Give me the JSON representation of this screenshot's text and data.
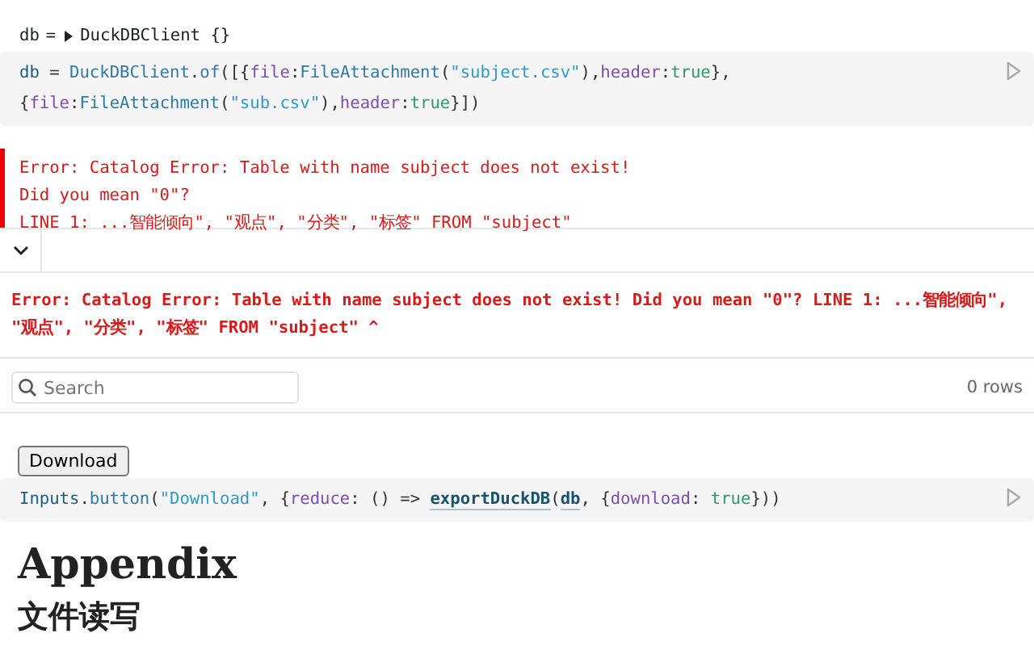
{
  "cells": [
    {
      "kind": "output",
      "name": "db",
      "sep": "=",
      "expanded": false,
      "value": "DuckDBClient {}"
    },
    {
      "kind": "code",
      "lines": [
        [
          {
            "t": "db",
            "kind": "var"
          },
          {
            "t": " = ",
            "kind": "plain"
          },
          {
            "t": "DuckDBClient",
            "kind": "def"
          },
          {
            "t": ".",
            "kind": "plain"
          },
          {
            "t": "of",
            "kind": "def"
          },
          {
            "t": "([{",
            "kind": "plain"
          },
          {
            "t": "file",
            "kind": "prop"
          },
          {
            "t": ":",
            "kind": "plain"
          },
          {
            "t": "FileAttachment",
            "kind": "def"
          },
          {
            "t": "(",
            "kind": "plain"
          },
          {
            "t": "\"subject.csv\"",
            "kind": "string"
          },
          {
            "t": "),",
            "kind": "plain"
          },
          {
            "t": "header",
            "kind": "prop"
          },
          {
            "t": ":",
            "kind": "plain"
          },
          {
            "t": "true",
            "kind": "bool"
          },
          {
            "t": "},",
            "kind": "plain"
          }
        ],
        [
          {
            "t": "{",
            "kind": "plain"
          },
          {
            "t": "file",
            "kind": "prop"
          },
          {
            "t": ":",
            "kind": "plain"
          },
          {
            "t": "FileAttachment",
            "kind": "def"
          },
          {
            "t": "(",
            "kind": "plain"
          },
          {
            "t": "\"sub.csv\"",
            "kind": "string"
          },
          {
            "t": "),",
            "kind": "plain"
          },
          {
            "t": "header",
            "kind": "prop"
          },
          {
            "t": ":",
            "kind": "plain"
          },
          {
            "t": "true",
            "kind": "bool"
          },
          {
            "t": "}])",
            "kind": "plain"
          }
        ]
      ]
    },
    {
      "kind": "error",
      "lines": [
        "Error: Catalog Error: Table with name subject does not exist!",
        "Did you mean \"0\"?",
        "LINE 1: ...智能倾向\", \"观点\", \"分类\", \"标签\" FROM \"subject\""
      ]
    },
    {
      "kind": "table",
      "expanded": true,
      "error": "Error: Catalog Error: Table with name subject does not exist! Did you mean \"0\"? LINE 1: ...智能倾向\", \"观点\", \"分类\", \"标签\" FROM \"subject\" ^",
      "search": {
        "placeholder": "Search"
      },
      "count": "0 rows"
    },
    {
      "kind": "button",
      "label": "Download"
    },
    {
      "kind": "code",
      "lines": [
        [
          {
            "t": "Inputs",
            "kind": "var"
          },
          {
            "t": ".",
            "kind": "plain"
          },
          {
            "t": "button",
            "kind": "def"
          },
          {
            "t": "(",
            "kind": "plain"
          },
          {
            "t": "\"Download\"",
            "kind": "string"
          },
          {
            "t": ", {",
            "kind": "plain"
          },
          {
            "t": "reduce",
            "kind": "prop"
          },
          {
            "t": ": () => ",
            "kind": "plain"
          },
          {
            "t": "exportDuckDB",
            "kind": "link"
          },
          {
            "t": "(",
            "kind": "plain"
          },
          {
            "t": "db",
            "kind": "link"
          },
          {
            "t": ", {",
            "kind": "plain"
          },
          {
            "t": "download",
            "kind": "prop"
          },
          {
            "t": ": ",
            "kind": "plain"
          },
          {
            "t": "true",
            "kind": "bool"
          },
          {
            "t": "}))",
            "kind": "plain"
          }
        ]
      ]
    },
    {
      "kind": "h1",
      "text": "Appendix"
    },
    {
      "kind": "h2",
      "text": "文件读写"
    }
  ]
}
